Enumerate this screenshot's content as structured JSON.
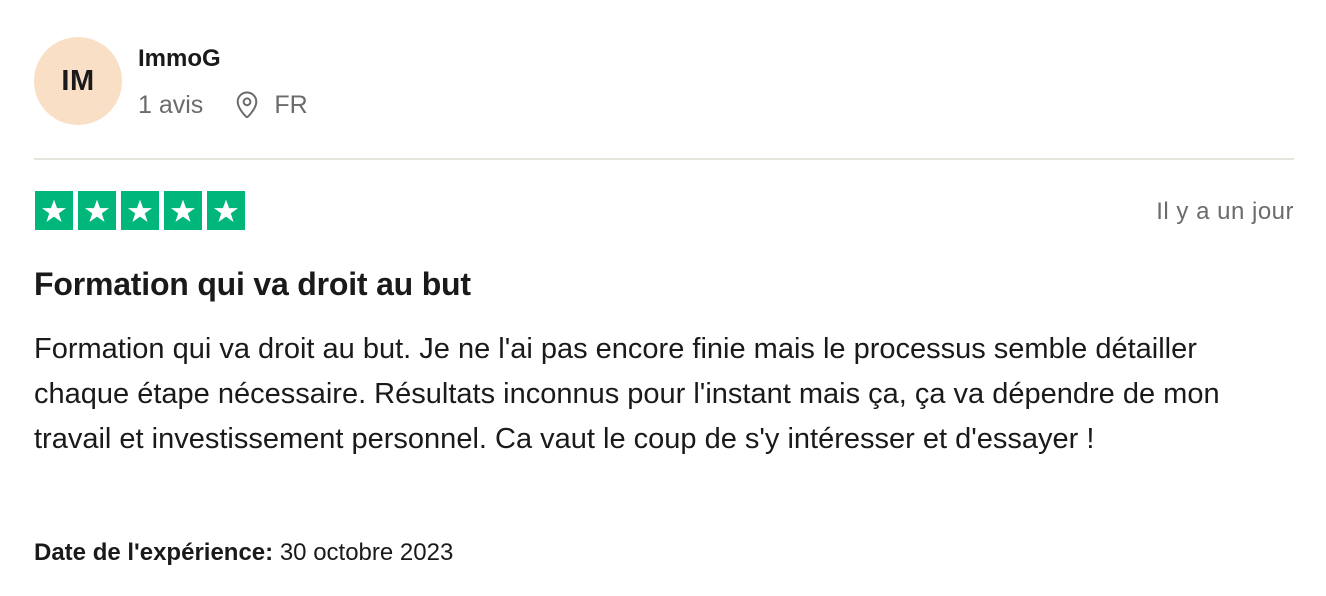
{
  "reviewer": {
    "initials": "IM",
    "name": "ImmoG",
    "review_count": "1 avis",
    "country": "FR",
    "avatar_color": "#f9dfc6"
  },
  "rating": {
    "stars": 5,
    "max_stars": 5,
    "color": "#00b67a"
  },
  "review": {
    "posted": "Il y a un jour",
    "title": "Formation qui va droit au but",
    "body": "Formation qui va droit au but. Je ne l'ai pas encore finie mais le processus semble détailler chaque étape nécessaire. Résultats inconnus pour l'instant mais ça, ça va dépendre de mon travail et investissement personnel. Ca vaut le coup de s'y intéresser et d'essayer !",
    "experience_label": "Date de l'expérience:",
    "experience_date": "30 octobre 2023"
  },
  "icons": {
    "location": "location-pin-icon",
    "star": "star-icon"
  }
}
